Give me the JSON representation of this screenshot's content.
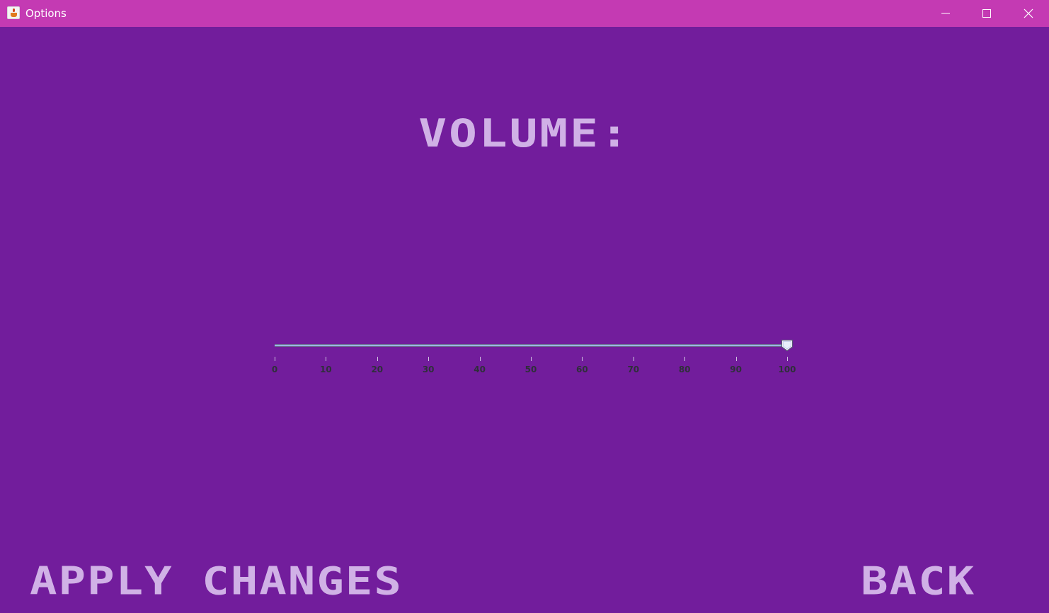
{
  "window": {
    "title": "Options",
    "icon": "java-cup-icon",
    "controls": {
      "minimize": "minimize-icon",
      "maximize": "maximize-icon",
      "close": "close-icon"
    }
  },
  "colors": {
    "background": "#721d9c",
    "titlebar": "#c43ab3",
    "text": "#d0b1e6"
  },
  "volume": {
    "label": "VOLUME:",
    "value": 100,
    "min": 0,
    "max": 100,
    "ticks": [
      "0",
      "10",
      "20",
      "30",
      "40",
      "50",
      "60",
      "70",
      "80",
      "90",
      "100"
    ]
  },
  "actions": {
    "apply_label": "APPLY CHANGES",
    "back_label": "BACK"
  }
}
